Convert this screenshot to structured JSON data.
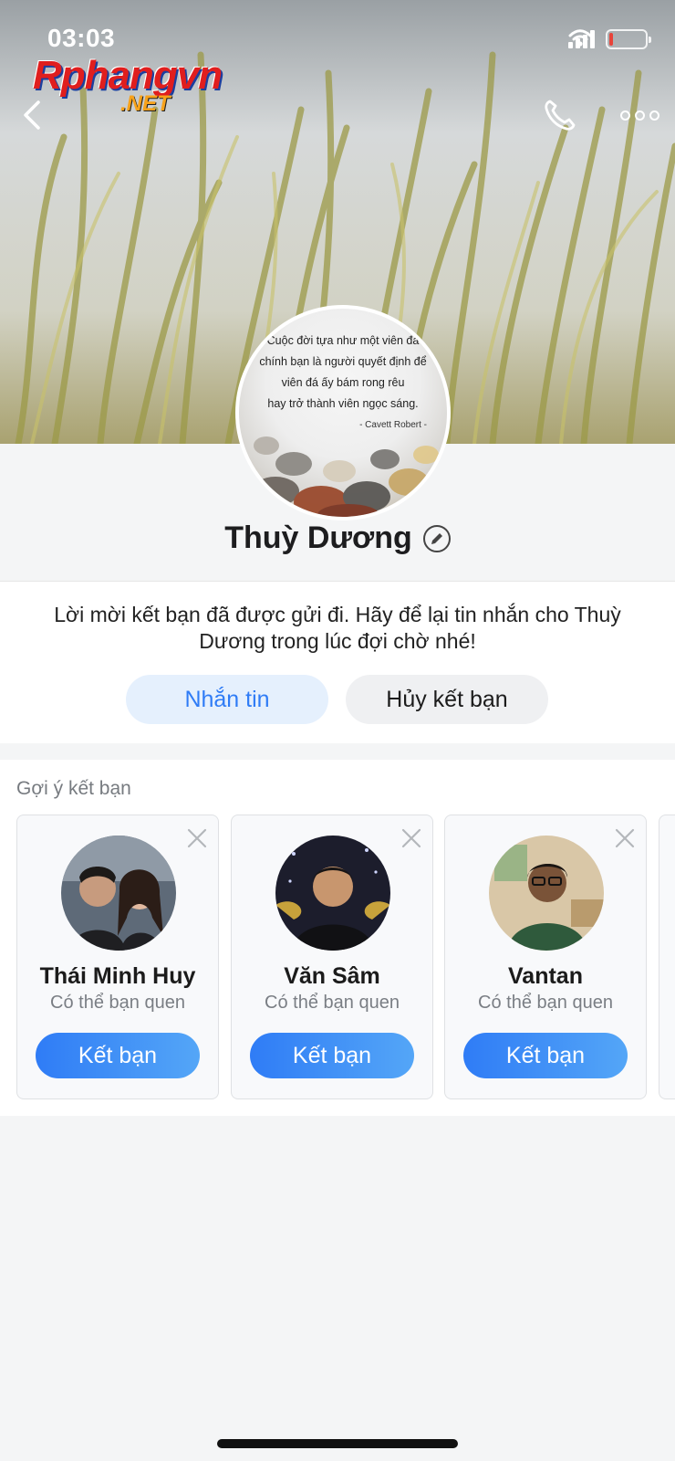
{
  "status_bar": {
    "time": "03:03"
  },
  "watermark": {
    "brand": "Rphangvn",
    "suffix": ".NET"
  },
  "header": {
    "back_icon": "chevron-left-icon",
    "call_icon": "phone-icon",
    "more_icon": "more-dots-icon"
  },
  "profile": {
    "avatar_quote_lines": [
      "Cuộc đời tựa như một viên đá",
      "chính bạn là người quyết định để",
      "viên đá ấy bám rong rêu",
      "hay trở thành viên ngọc sáng."
    ],
    "avatar_quote_author": "- Cavett Robert -",
    "name": "Thuỳ Dương"
  },
  "friend_request": {
    "message": "Lời mời kết bạn đã được gửi đi. Hãy để lại tin nhắn cho Thuỳ Dương trong lúc đợi chờ nhé!",
    "message_button": "Nhắn tin",
    "unfriend_button": "Hủy kết bạn"
  },
  "suggestions": {
    "title": "Gợi ý kết bạn",
    "items": [
      {
        "name": "Thái Minh Huy",
        "subtitle": "Có thể bạn quen",
        "button": "Kết bạn"
      },
      {
        "name": "Văn Sâm",
        "subtitle": "Có thể bạn quen",
        "button": "Kết bạn"
      },
      {
        "name": "Vantan",
        "subtitle": "Có thể bạn quen",
        "button": "Kết bạn"
      }
    ]
  },
  "colors": {
    "accent": "#2f7cf6",
    "accent_light": "#e5f0fd",
    "battery_low": "#e8443a"
  }
}
